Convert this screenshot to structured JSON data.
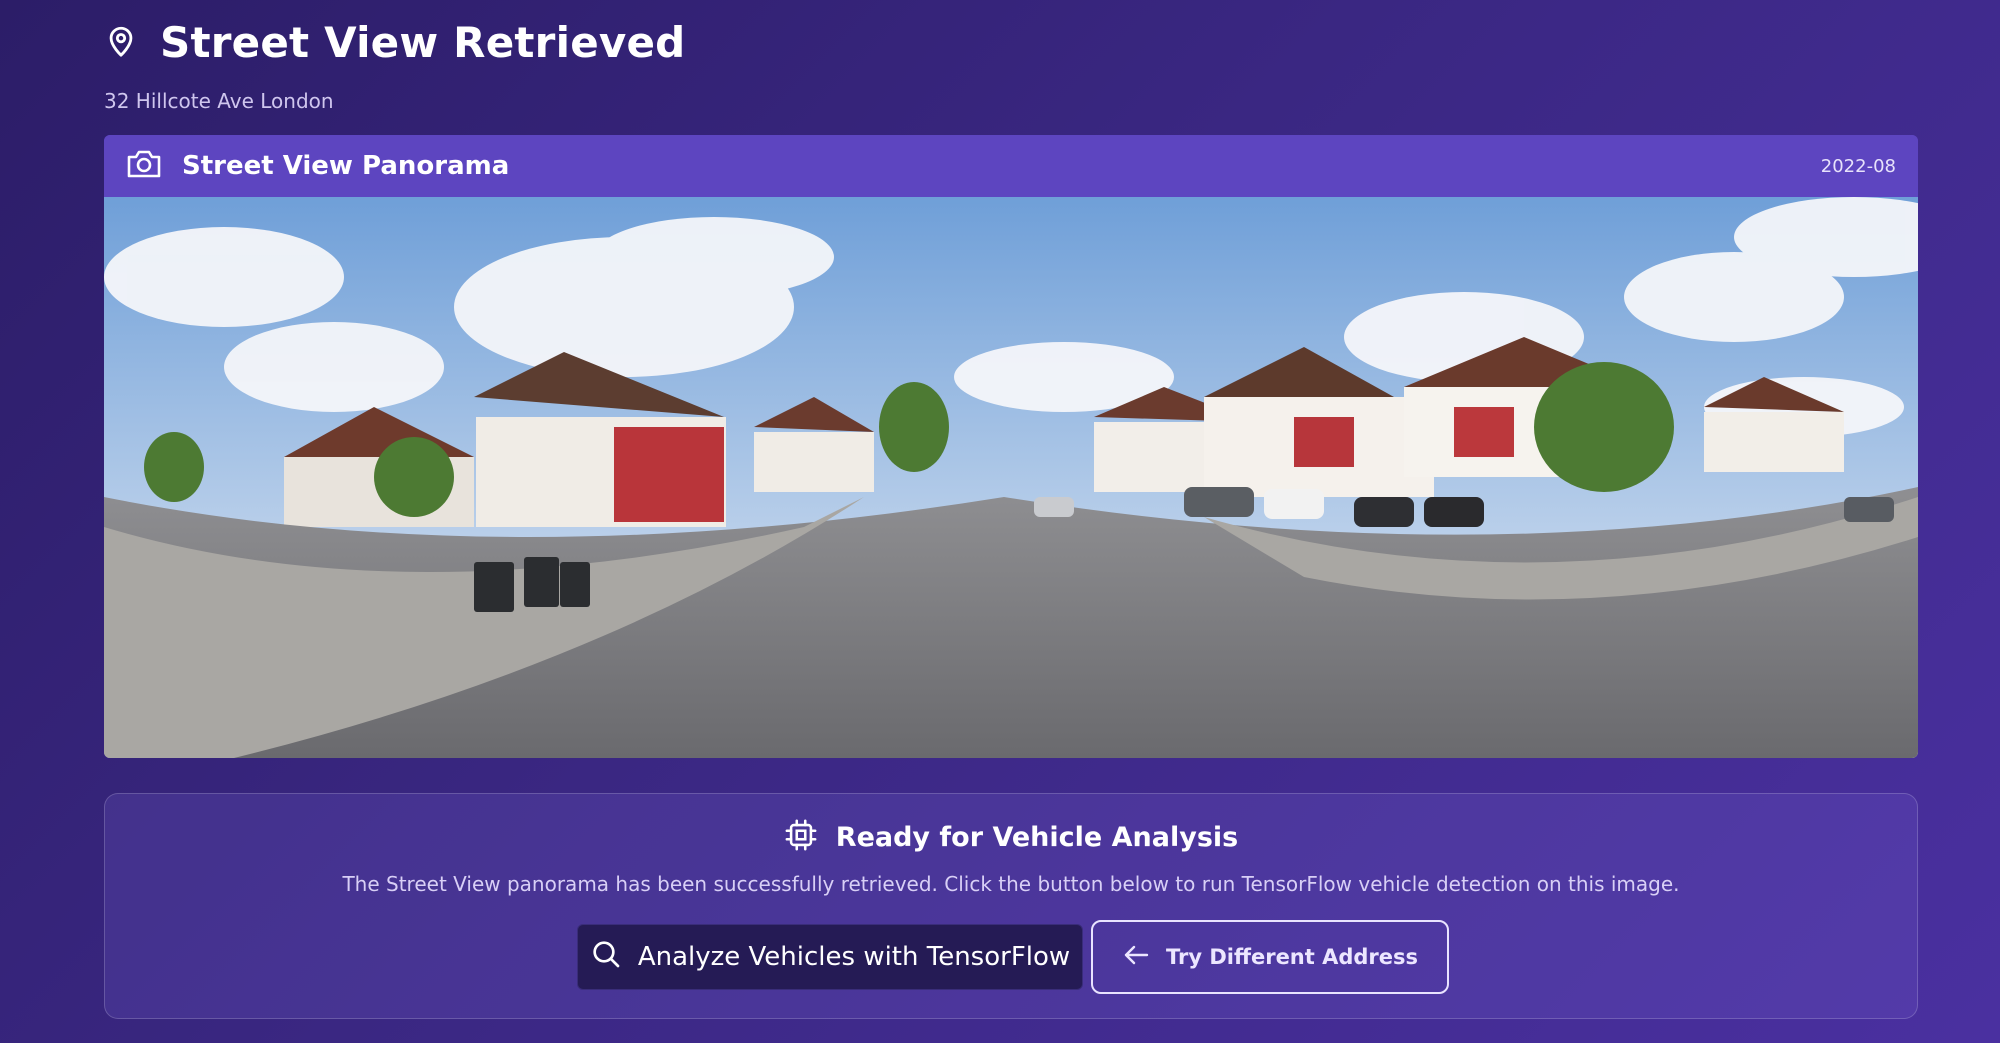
{
  "header": {
    "title": "Street View Retrieved",
    "address": "32 Hillcote Ave London",
    "icon": "map-pin-icon"
  },
  "panorama": {
    "title": "Street View Panorama",
    "date": "2022-08",
    "icon": "camera-icon"
  },
  "analysis": {
    "title": "Ready for Vehicle Analysis",
    "description": "The Street View panorama has been successfully retrieved. Click the button below to run TensorFlow vehicle detection on this image.",
    "icon": "cpu-chip-icon",
    "analyze_button": "Analyze Vehicles with TensorFlow",
    "try_button": "Try Different Address"
  },
  "colors": {
    "background": "#33237a",
    "panel_header": "#5d45c0",
    "analyze_button": "#251b55",
    "text_muted": "#d8cff6"
  }
}
